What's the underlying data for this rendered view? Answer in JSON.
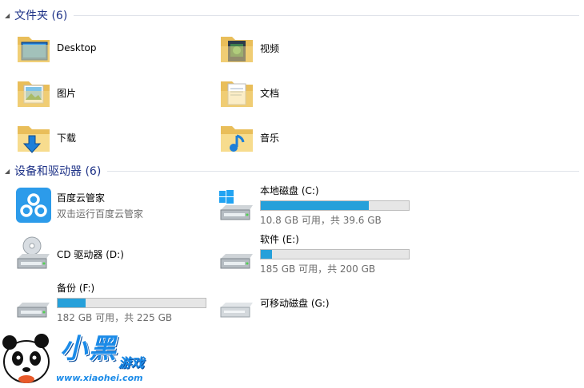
{
  "groups": {
    "folders": {
      "title": "文件夹 (6)"
    },
    "devices": {
      "title": "设备和驱动器 (6)"
    }
  },
  "folders": [
    {
      "label": "Desktop",
      "icon": "desktop-folder-icon"
    },
    {
      "label": "视频",
      "icon": "videos-folder-icon"
    },
    {
      "label": "图片",
      "icon": "pictures-folder-icon"
    },
    {
      "label": "文档",
      "icon": "documents-folder-icon"
    },
    {
      "label": "下载",
      "icon": "downloads-folder-icon"
    },
    {
      "label": "音乐",
      "icon": "music-folder-icon"
    }
  ],
  "devices": [
    {
      "name": "百度云管家",
      "sub": "双击运行百度云管家",
      "icon": "baidu-cloud-icon"
    },
    {
      "name": "本地磁盘 (C:)",
      "sub": "10.8 GB 可用，共 39.6 GB",
      "used_fraction": 0.73,
      "icon": "windows-drive-icon"
    },
    {
      "name": "CD 驱动器 (D:)",
      "icon": "cd-drive-icon"
    },
    {
      "name": "软件 (E:)",
      "sub": "185 GB 可用，共 200 GB",
      "used_fraction": 0.075,
      "icon": "hard-drive-icon"
    },
    {
      "name": "备份 (F:)",
      "sub": "182 GB 可用，共 225 GB",
      "used_fraction": 0.19,
      "icon": "hard-drive-icon"
    },
    {
      "name": "可移动磁盘 (G:)",
      "icon": "removable-drive-icon"
    }
  ],
  "watermark": {
    "brand": "小黑",
    "brand_sub": "游戏",
    "url": "www.xiaohei.com"
  },
  "colors": {
    "accent": "#1e3287",
    "bar_fill": "#26a0da",
    "folder": "#f3d27a"
  }
}
